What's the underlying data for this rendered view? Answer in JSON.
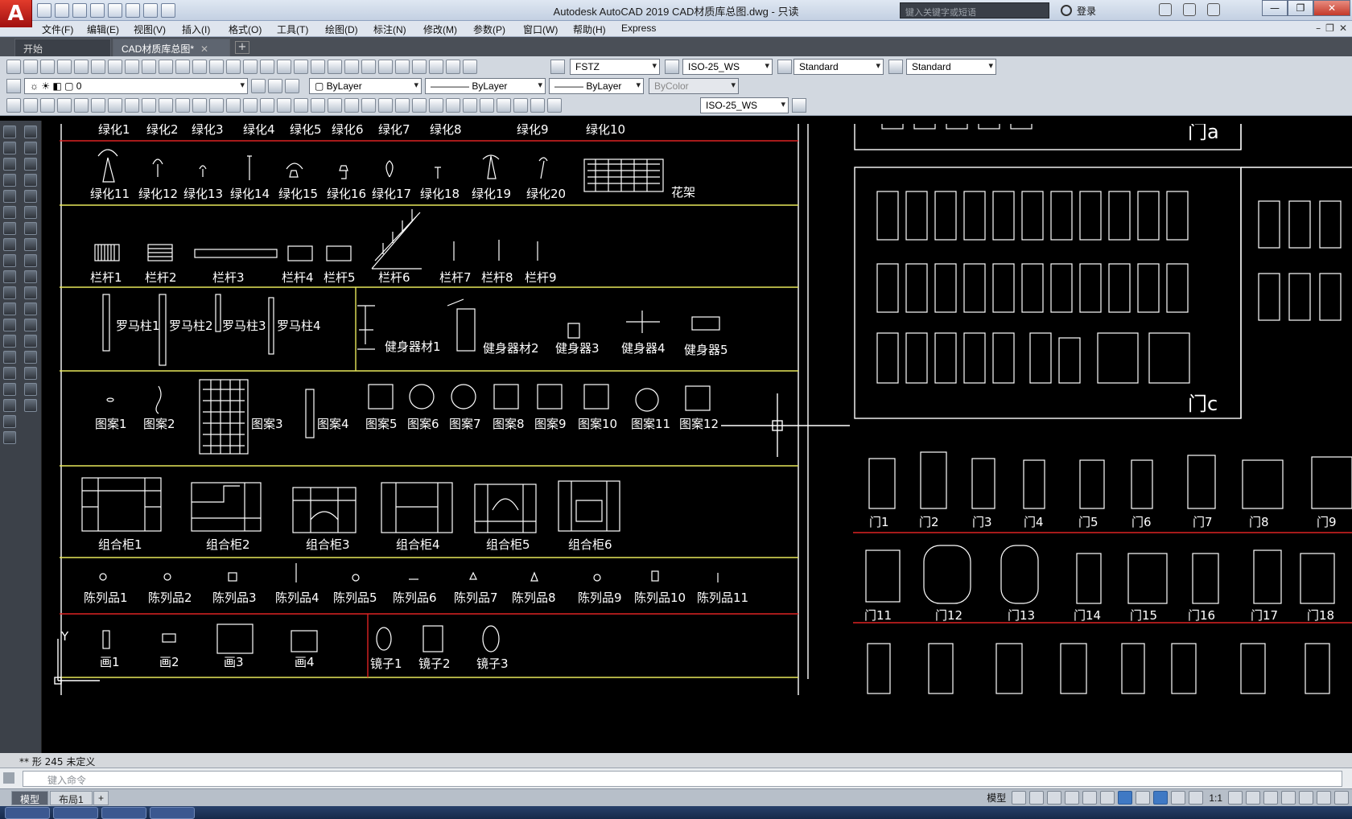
{
  "app": {
    "logo_letter": "A",
    "window_title": "Autodesk AutoCAD 2019    CAD材质库总图.dwg - 只读",
    "search_placeholder": "键入关键字或短语",
    "signin_label": "登录",
    "window_controls": [
      "—",
      "❐",
      "✕"
    ]
  },
  "menu": [
    "文件(F)",
    "编辑(E)",
    "视图(V)",
    "插入(I)",
    "格式(O)",
    "工具(T)",
    "绘图(D)",
    "标注(N)",
    "修改(M)",
    "参数(P)",
    "窗口(W)",
    "帮助(H)",
    "Express"
  ],
  "menu_right": [
    "–",
    "❐",
    "✕"
  ],
  "tabs": {
    "start": "开始",
    "drawing": "CAD材质库总图*",
    "close": "✕",
    "add": "+"
  },
  "toolbar1": {
    "text_style": "FSTZ",
    "dim_style": "ISO-25_WS",
    "table_style": "Standard",
    "mleader_style": "Standard"
  },
  "toolbar2": {
    "layer": "0",
    "color": "ByLayer",
    "linetype": "ByLayer",
    "lineweight": "ByLayer",
    "plotstyle": "ByColor"
  },
  "toolbar3": {
    "dim_style": "ISO-25_WS"
  },
  "drawing": {
    "row_greenery_top": [
      "绿化1",
      "绿化2",
      "绿化3",
      "绿化4",
      "绿化5",
      "绿化6",
      "绿化7",
      "绿化8",
      "绿化9",
      "绿化10"
    ],
    "row_greenery": [
      "绿化11",
      "绿化12",
      "绿化13",
      "绿化14",
      "绿化15",
      "绿化16",
      "绿化17",
      "绿化18",
      "绿化19",
      "绿化20",
      "花架"
    ],
    "row_railing": [
      "栏杆1",
      "栏杆2",
      "栏杆3",
      "栏杆4",
      "栏杆5",
      "栏杆6",
      "栏杆7",
      "栏杆8",
      "栏杆9"
    ],
    "row_columns": [
      "罗马柱1",
      "罗马柱2",
      "罗马柱3",
      "罗马柱4"
    ],
    "row_fitness": [
      "健身器材1",
      "健身器材2",
      "健身器3",
      "健身器4",
      "健身器5"
    ],
    "row_patterns": [
      "图案1",
      "图案2",
      "图案3",
      "图案4",
      "图案5",
      "图案6",
      "图案7",
      "图案8",
      "图案9",
      "图案10",
      "图案11",
      "图案12"
    ],
    "row_cabinets": [
      "组合柜1",
      "组合柜2",
      "组合柜3",
      "组合柜4",
      "组合柜5",
      "组合柜6"
    ],
    "row_display": [
      "陈列品1",
      "陈列品2",
      "陈列品3",
      "陈列品4",
      "陈列品5",
      "陈列品6",
      "陈列品7",
      "陈列品8",
      "陈列品9",
      "陈列品10",
      "陈列品11"
    ],
    "row_paintings": [
      "画1",
      "画2",
      "画3",
      "画4"
    ],
    "row_mirrors": [
      "镜子1",
      "镜子2",
      "镜子3"
    ],
    "door_a_label": "门a",
    "door_c_label": "门c",
    "doors_row1": [
      "门1",
      "门2",
      "门3",
      "门4",
      "门5",
      "门6",
      "门7",
      "门8",
      "门9"
    ],
    "doors_row2": [
      "门11",
      "门12",
      "门13",
      "门14",
      "门15",
      "门16",
      "门17",
      "门18"
    ],
    "ucs_y": "Y"
  },
  "command": {
    "history": "**  形  245  未定义",
    "prompt": "键入命令"
  },
  "status": {
    "model_tab": "模型",
    "layout_tab": "布局1",
    "add": "+",
    "model_label": "模型",
    "scale": "1:1"
  }
}
